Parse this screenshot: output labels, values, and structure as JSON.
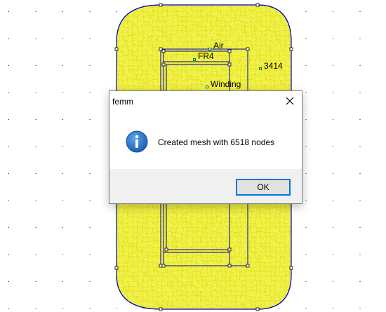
{
  "colors": {
    "mesh_fill": "#f2f250",
    "mesh_line": "#d9d900",
    "boundary": "#0000c0",
    "grid_dot": "#0000aa",
    "label_marker": "#008000",
    "dialog_accent": "#0078d7",
    "info_blue": "#1f6fc5"
  },
  "labels": {
    "air": "Air",
    "fr4": "FR4",
    "turns": "3414",
    "winding": "Winding"
  },
  "dialog": {
    "title": "femm",
    "icon": "info-icon",
    "message": "Created mesh with 6518 nodes",
    "ok_label": "OK",
    "close_icon": "close-icon"
  }
}
